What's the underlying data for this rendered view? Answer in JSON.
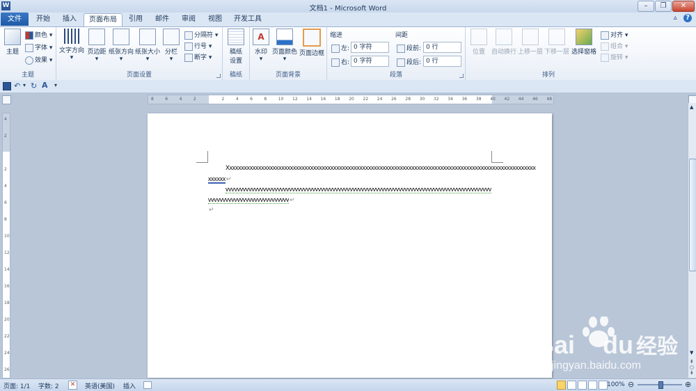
{
  "title": {
    "app_icon": "W",
    "text": "文档1 - Microsoft Word",
    "minimize": "–",
    "restore": "❐",
    "close": "✕"
  },
  "tabs": {
    "file": "文件",
    "items": [
      "开始",
      "插入",
      "页面布局",
      "引用",
      "邮件",
      "审阅",
      "视图",
      "开发工具"
    ],
    "active": "页面布局",
    "minimize_ribbon": "▵",
    "help": "?"
  },
  "ribbon": {
    "theme": {
      "label": "主题",
      "btn": "主题",
      "colors": "颜色",
      "fonts": "字体",
      "effects": "效果"
    },
    "page_setup": {
      "label": "页面设置",
      "text_direction": "文字方向",
      "margins": "页边距",
      "orientation": "纸张方向",
      "size": "纸张大小",
      "columns": "分栏",
      "breaks": "分隔符",
      "line_numbers": "行号",
      "hyphenation": "断字"
    },
    "draft_paper": {
      "label": "稿纸",
      "btn_line1": "稿纸",
      "btn_line2": "设置"
    },
    "page_background": {
      "label": "页面背景",
      "watermark": "水印",
      "page_color": "页面颜色",
      "page_borders": "页面边框"
    },
    "paragraph": {
      "label": "段落",
      "indent_title": "缩进",
      "spacing_title": "间距",
      "indent_left_label": "左:",
      "indent_left_value": "0 字符",
      "indent_right_label": "右:",
      "indent_right_value": "0 字符",
      "spacing_before_label": "段前:",
      "spacing_before_value": "0 行",
      "spacing_after_label": "段后:",
      "spacing_after_value": "0 行"
    },
    "arrange": {
      "label": "排列",
      "position": "位置",
      "wrap_text": "自动换行",
      "bring_forward": "上移一层",
      "send_backward": "下移一层",
      "selection_pane": "选择窗格",
      "align": "对齐",
      "group": "组合",
      "rotate": "旋转"
    }
  },
  "qat": {
    "save_icon": "save-icon",
    "undo": "↶",
    "redo": "↻",
    "format": "A"
  },
  "ruler": {
    "h_ticks": [
      "8",
      "6",
      "4",
      "2",
      "",
      "2",
      "4",
      "6",
      "8",
      "10",
      "12",
      "14",
      "16",
      "18",
      "20",
      "22",
      "24",
      "26",
      "28",
      "30",
      "32",
      "34",
      "36",
      "38",
      "40",
      "42",
      "44",
      "46",
      "48"
    ],
    "v_ticks": [
      "4",
      "2",
      "",
      "2",
      "4",
      "6",
      "8",
      "10",
      "12",
      "14",
      "16",
      "18",
      "20",
      "22",
      "24",
      "26"
    ]
  },
  "document": {
    "line1": "Xxxxxxxxxxxxxxxxxxxxxxxxxxxxxxxxxxxxxxxxxxxxxxxxxxxxxxxxxxxxxxxxxxxxxxxxxxxxxxxxxxxxxxxxxxxxxxxxxxxxxxxxxxx",
    "line2": "xxxxxx",
    "line3": "vvvvvvvvvvvvvvvvvvvvvvvvvvvvvvvvvvvvvvvvvvvvvvvvvvvvvvvvvvvvvvvvvvvvvvvvvvvvvvvvvvvvvvvvvvvv",
    "line4": "vvvvvvvvvvvvvvvvvvvvvvvvvvvv",
    "para_mark": "↵"
  },
  "status": {
    "page": "页面: 1/1",
    "words": "字数: 2",
    "language": "英语(美国)",
    "mode": "插入",
    "zoom": "100%",
    "zoom_level": 0.5,
    "zoom_out": "⊖",
    "zoom_in": "⊕"
  },
  "watermark": {
    "brand": "Bai",
    "brand2": "du",
    "cn": "经验",
    "url": "jingyan.baidu.com"
  },
  "colors": {
    "accent": "#2b5797",
    "ribbon_border": "#9ab2d2",
    "spell_green": "#3c9c3c"
  }
}
